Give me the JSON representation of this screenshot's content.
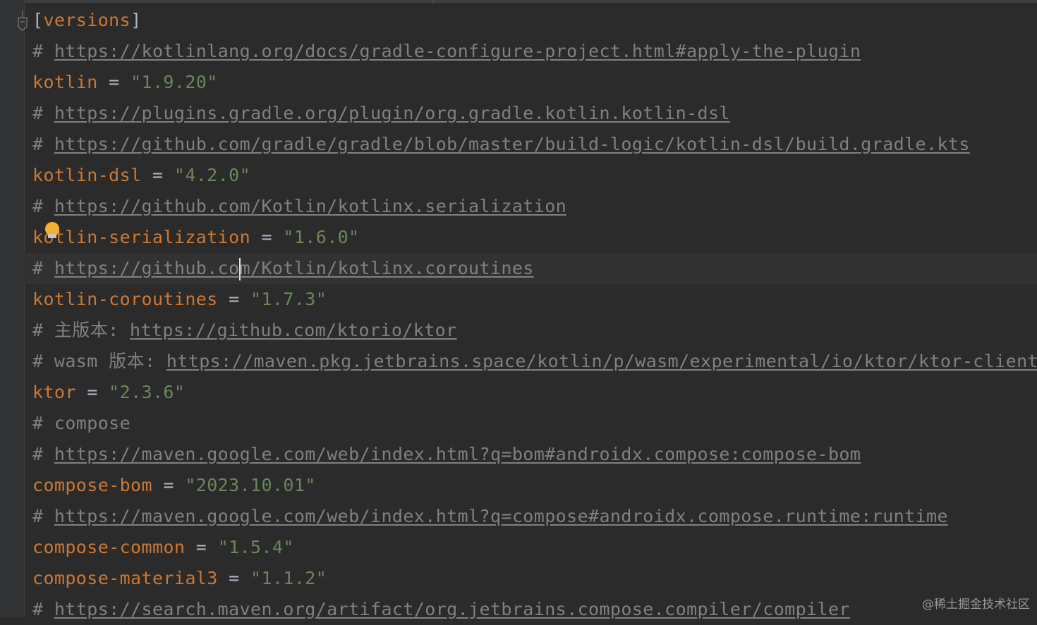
{
  "editor": {
    "lines": [
      {
        "type": "header",
        "bracket_open": "[",
        "name": "versions",
        "bracket_close": "]"
      },
      {
        "type": "comment",
        "hash": "#",
        "url": "https://kotlinlang.org/docs/gradle-configure-project.html#apply-the-plugin"
      },
      {
        "type": "assign",
        "key": "kotlin",
        "eq": "=",
        "value": "\"1.9.20\""
      },
      {
        "type": "comment",
        "hash": "#",
        "url": "https://plugins.gradle.org/plugin/org.gradle.kotlin.kotlin-dsl"
      },
      {
        "type": "comment",
        "hash": "#",
        "url": "https://github.com/gradle/gradle/blob/master/build-logic/kotlin-dsl/build.gradle.kts"
      },
      {
        "type": "assign",
        "key": "kotlin-dsl",
        "eq": "=",
        "value": "\"4.2.0\""
      },
      {
        "type": "comment",
        "hash": "#",
        "url": "https://github.com/Kotlin/kotlinx.serialization"
      },
      {
        "type": "assign",
        "key": "kotlin-serialization",
        "eq": "=",
        "value": "\"1.6.0\""
      },
      {
        "type": "comment_caret",
        "hash": "#",
        "url_before": "https://github.co",
        "url_after": "m/Kotlin/kotlinx.coroutines"
      },
      {
        "type": "assign",
        "key": "kotlin-coroutines",
        "eq": "=",
        "value": "\"1.7.3\""
      },
      {
        "type": "comment_text_url",
        "hash": "#",
        "text": "主版本:",
        "url": "https://github.com/ktorio/ktor"
      },
      {
        "type": "comment_text_url",
        "hash": "#",
        "text": "wasm 版本:",
        "url": "https://maven.pkg.jetbrains.space/kotlin/p/wasm/experimental/io/ktor/ktor-client"
      },
      {
        "type": "assign",
        "key": "ktor",
        "eq": "=",
        "value": "\"2.3.6\""
      },
      {
        "type": "comment_text",
        "hash": "#",
        "text": "compose"
      },
      {
        "type": "comment",
        "hash": "#",
        "url": "https://maven.google.com/web/index.html?q=bom#androidx.compose:compose-bom"
      },
      {
        "type": "assign",
        "key": "compose-bom",
        "eq": "=",
        "value": "\"2023.10.01\""
      },
      {
        "type": "comment",
        "hash": "#",
        "url": "https://maven.google.com/web/index.html?q=compose#androidx.compose.runtime:runtime"
      },
      {
        "type": "assign",
        "key": "compose-common",
        "eq": "=",
        "value": "\"1.5.4\""
      },
      {
        "type": "assign",
        "key": "compose-material3",
        "eq": "=",
        "value": "\"1.1.2\""
      },
      {
        "type": "comment",
        "hash": "#",
        "url": "https://search.maven.org/artifact/org.jetbrains.compose.compiler/compiler"
      }
    ]
  },
  "watermark": "@稀土掘金技术社区",
  "colors": {
    "background": "#2b2b2b",
    "keyword": "#cc7832",
    "string": "#6a8759",
    "comment": "#808080",
    "operator": "#a9b7c6"
  }
}
